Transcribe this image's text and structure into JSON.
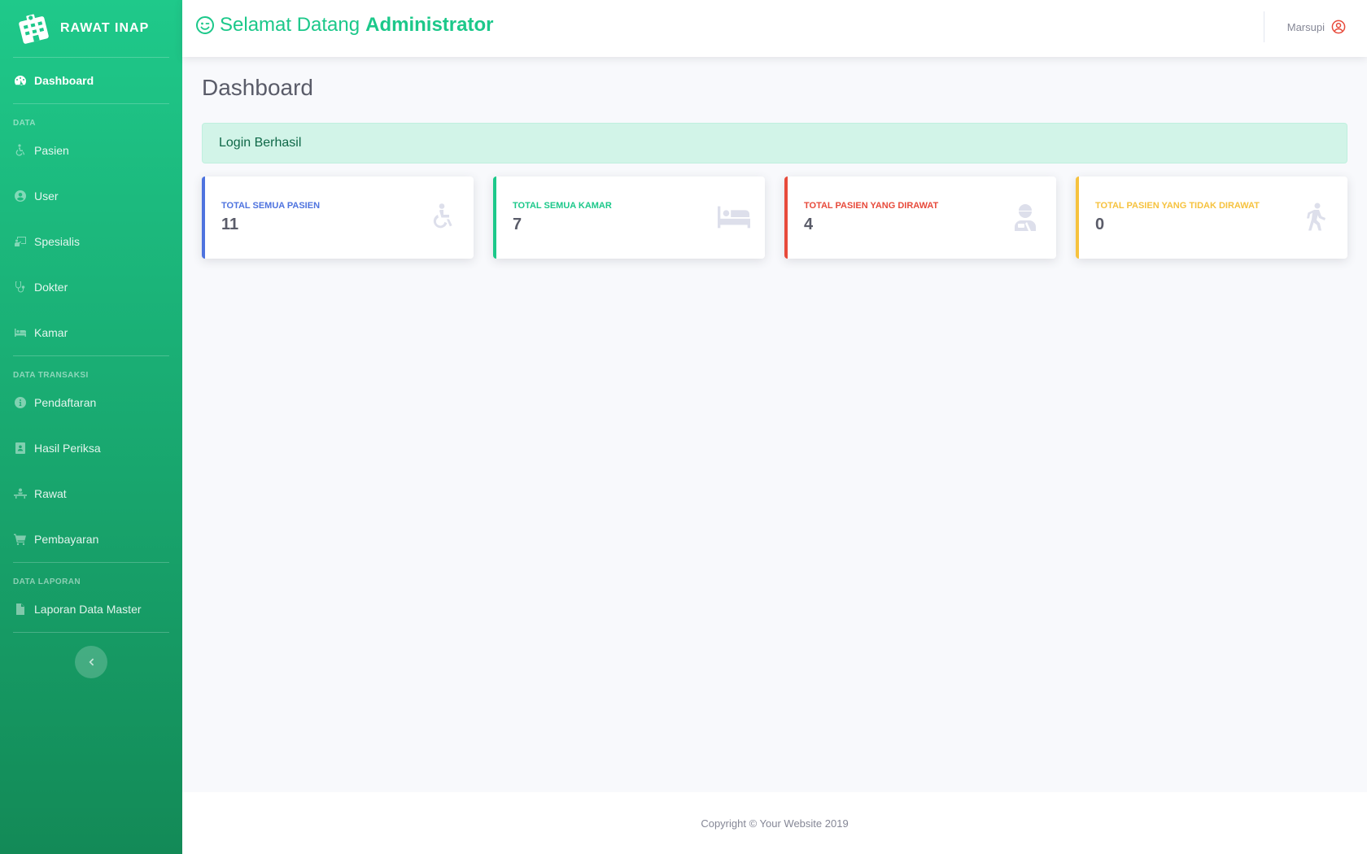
{
  "brand": {
    "name": "RAWAT INAP"
  },
  "sidebar": {
    "dashboard": {
      "label": "Dashboard",
      "icon": "tachometer-icon"
    },
    "sections": {
      "data": "DATA",
      "transaksi": "DATA TRANSAKSI",
      "laporan": "DATA LAPORAN"
    },
    "items": [
      {
        "label": "Pasien",
        "icon": "wheelchair-icon"
      },
      {
        "label": "User",
        "icon": "user-circle-icon"
      },
      {
        "label": "Spesialis",
        "icon": "chalkboard-icon"
      },
      {
        "label": "Dokter",
        "icon": "stethoscope-icon"
      },
      {
        "label": "Kamar",
        "icon": "bed-icon"
      },
      {
        "label": "Pendaftaran",
        "icon": "info-circle-icon"
      },
      {
        "label": "Hasil Periksa",
        "icon": "address-book-icon"
      },
      {
        "label": "Rawat",
        "icon": "procedures-icon"
      },
      {
        "label": "Pembayaran",
        "icon": "cart-icon"
      },
      {
        "label": "Laporan Data Master",
        "icon": "file-icon"
      }
    ]
  },
  "topbar": {
    "welcome_prefix": "Selamat Datang",
    "welcome_role": "Administrator",
    "user_name": "Marsupi"
  },
  "main": {
    "title": "Dashboard",
    "alert": "Login Berhasil",
    "cards": [
      {
        "label": "TOTAL SEMUA PASIEN",
        "value": "11",
        "color": "#4e73df",
        "icon": "wheelchair-icon"
      },
      {
        "label": "TOTAL SEMUA KAMAR",
        "value": "7",
        "color": "#1cc88a",
        "icon": "bed-icon"
      },
      {
        "label": "TOTAL PASIEN YANG DIRAWAT",
        "value": "4",
        "color": "#e74a3b",
        "icon": "user-injured-icon"
      },
      {
        "label": "TOTAL PASIEN YANG TIDAK DIRAWAT",
        "value": "0",
        "color": "#f6c23e",
        "icon": "walking-icon"
      }
    ]
  },
  "footer": {
    "copyright": "Copyright © Your Website 2019"
  },
  "colors": {
    "primary": "#4e73df",
    "success": "#1cc88a",
    "danger": "#e74a3b",
    "warning": "#f6c23e"
  }
}
